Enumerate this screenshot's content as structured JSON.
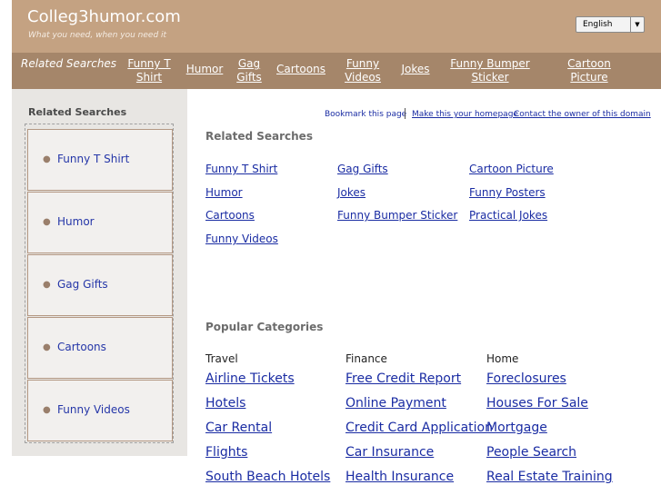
{
  "header": {
    "title": "Colleg3humor.com",
    "tagline": "What you need, when you need it",
    "language": "English"
  },
  "nav": {
    "label": "Related Searches",
    "items": [
      "Funny T Shirt",
      "Humor",
      "Gag Gifts",
      "Cartoons",
      "Funny Videos",
      "Jokes",
      "Funny Bumper Sticker",
      "Cartoon Picture"
    ]
  },
  "sidebar": {
    "title": "Related Searches",
    "items": [
      "Funny T Shirt",
      "Humor",
      "Gag Gifts",
      "Cartoons",
      "Funny Videos"
    ]
  },
  "toplinks": {
    "bookmark": "Bookmark this page",
    "homepage": "Make this your homepage",
    "contact": "Contact the owner of this domain"
  },
  "related": {
    "heading": "Related Searches",
    "col1": [
      "Funny T Shirt",
      "Humor",
      "Cartoons",
      "Funny Videos"
    ],
    "col2": [
      "Gag Gifts",
      "Jokes",
      "Funny Bumper Sticker"
    ],
    "col3": [
      "Cartoon Picture",
      "Funny Posters",
      "Practical Jokes"
    ]
  },
  "popular": {
    "heading": "Popular Categories",
    "columns": [
      {
        "title": "Travel",
        "links": [
          "Airline Tickets",
          "Hotels",
          "Car Rental",
          "Flights",
          "South Beach Hotels"
        ]
      },
      {
        "title": "Finance",
        "links": [
          "Free Credit Report",
          "Online Payment",
          "Credit Card Application",
          "Car Insurance",
          "Health Insurance"
        ]
      },
      {
        "title": "Home",
        "links": [
          "Foreclosures",
          "Houses For Sale",
          "Mortgage",
          "People Search",
          "Real Estate Training"
        ]
      }
    ]
  }
}
